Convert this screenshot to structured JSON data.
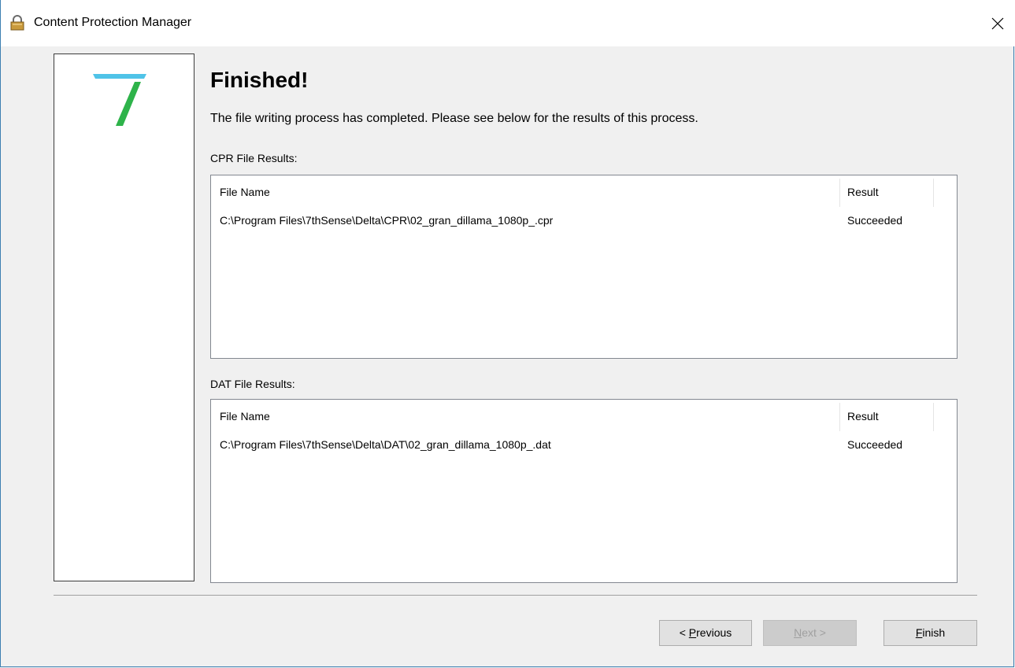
{
  "window": {
    "title": "Content Protection Manager",
    "accent_color": "#3c7fb1"
  },
  "page": {
    "heading": "Finished!",
    "subtitle": "The file writing process has completed. Please see below for the results of this process."
  },
  "cpr": {
    "label": "CPR File Results:",
    "columns": {
      "file_name": "File Name",
      "result": "Result"
    },
    "rows": [
      {
        "file_name": "C:\\Program Files\\7thSense\\Delta\\CPR\\02_gran_dillama_1080p_.cpr",
        "result": "Succeeded"
      }
    ]
  },
  "dat": {
    "label": "DAT File Results:",
    "columns": {
      "file_name": "File Name",
      "result": "Result"
    },
    "rows": [
      {
        "file_name": "C:\\Program Files\\7thSense\\Delta\\DAT\\02_gran_dillama_1080p_.dat",
        "result": "Succeeded"
      }
    ]
  },
  "buttons": {
    "previous": {
      "prefix": "< ",
      "mnemonic": "P",
      "rest": "revious"
    },
    "next": {
      "mnemonic": "N",
      "rest": "ext >"
    },
    "finish": {
      "mnemonic": "F",
      "rest": "inish"
    }
  },
  "icons": {
    "app": "lock-icon",
    "close": "close-icon",
    "logo": "seven-logo-icon"
  },
  "colors": {
    "logo_blue": "#4fc3e8",
    "logo_green": "#2eb34a"
  }
}
